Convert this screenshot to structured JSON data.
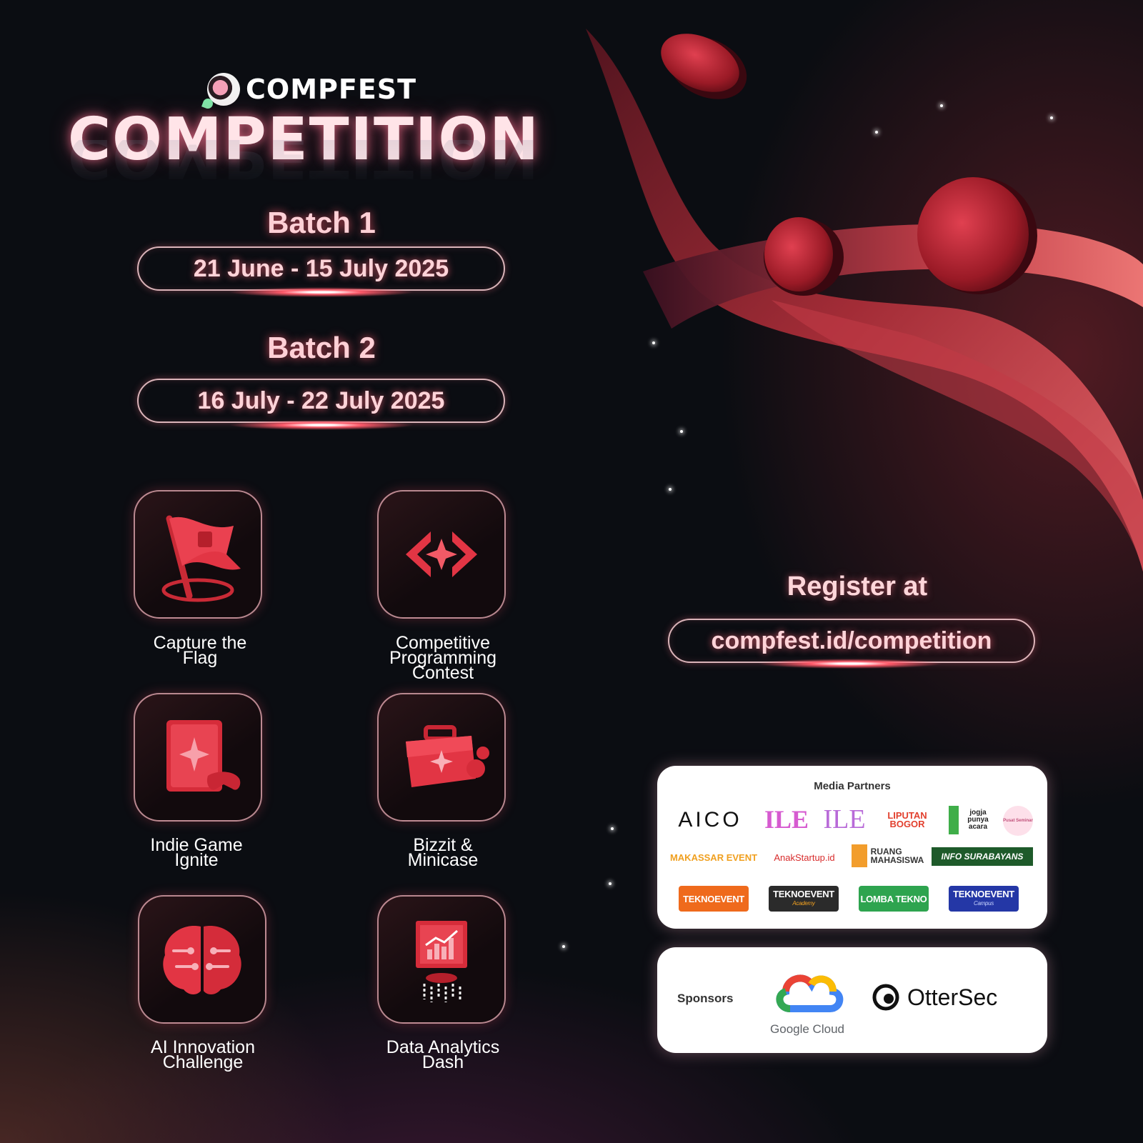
{
  "header": {
    "brand": "COMPFEST",
    "title": "COMPETITION"
  },
  "batches": [
    {
      "label": "Batch 1",
      "dates": "21 June - 15 July 2025"
    },
    {
      "label": "Batch 2",
      "dates": "16 July - 22 July 2025"
    }
  ],
  "competitions": [
    {
      "label": "Capture the\nFlag",
      "icon": "flag-icon"
    },
    {
      "label": "Competitive\nProgramming\nContest",
      "icon": "code-brackets-icon"
    },
    {
      "label": "Indie Game\nIgnite",
      "icon": "game-console-icon"
    },
    {
      "label": "Bizzit &\nMinicase",
      "icon": "briefcase-icon"
    },
    {
      "label": "AI Innovation\nChallenge",
      "icon": "brain-icon"
    },
    {
      "label": "Data Analytics\nDash",
      "icon": "analytics-chart-icon"
    }
  ],
  "register": {
    "label": "Register at",
    "url": "compfest.id/competition"
  },
  "media_partners": {
    "heading": "Media Partners",
    "logos": [
      "AICO",
      "ILE",
      "ILE",
      "LIPUTAN BOGOR",
      "jogja punya acara",
      "Pusat Seminar",
      "MAKASSAR EVENT",
      "AnakStartup.id",
      "RUANG MAHASISWA",
      "INFO SURABAYANS",
      "TEKNOEVENT",
      "TEKNOEVENT",
      "LOMBA TEKNO",
      "TEKNOEVENT"
    ],
    "sublabels": [
      "Academy",
      "Campus"
    ]
  },
  "sponsors": {
    "heading": "Sponsors",
    "logos": [
      "Google Cloud",
      "OtterSec"
    ]
  },
  "colors": {
    "accent": "#e0303c",
    "glow": "#ff6b80",
    "background": "#0b0d12"
  }
}
